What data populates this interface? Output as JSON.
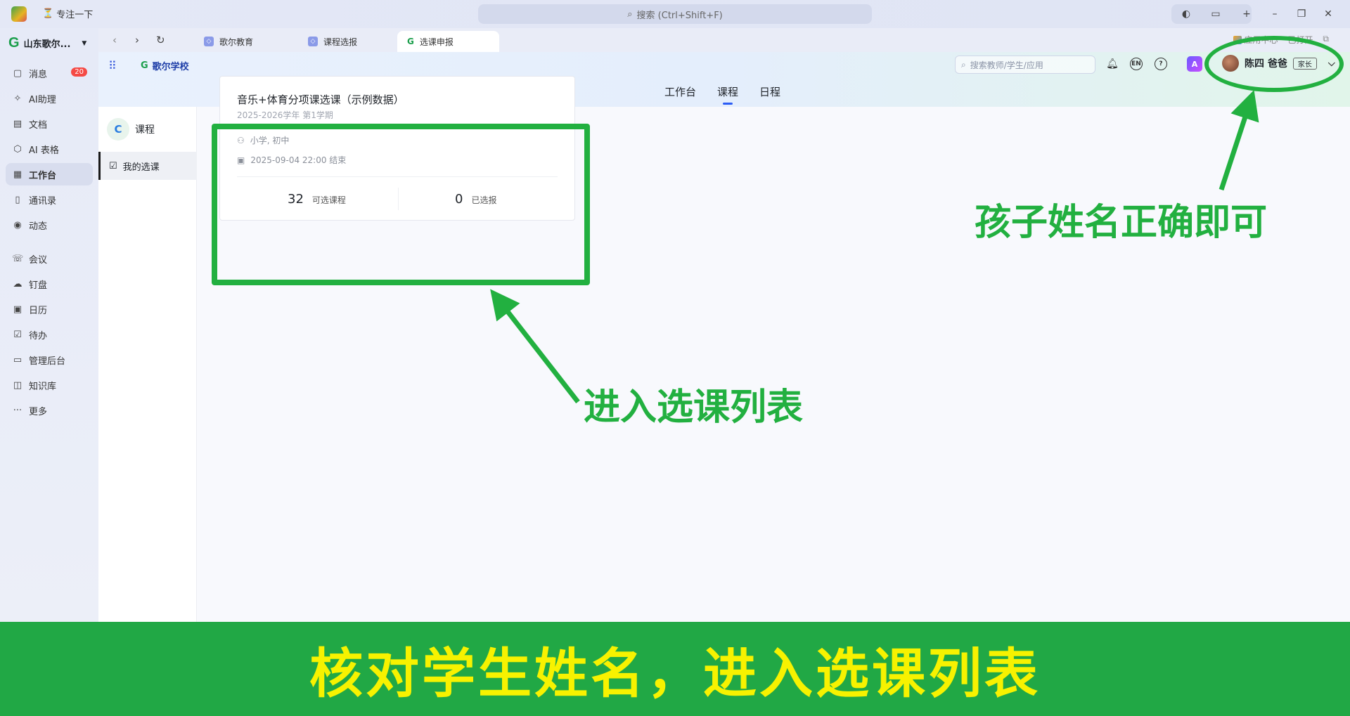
{
  "titlebar": {
    "focus_label": "专注一下",
    "search_placeholder": "搜索 (Ctrl+Shift+F)"
  },
  "sidebar": {
    "org_name": "山东歌尔...",
    "items": [
      {
        "label": "消息",
        "icon": "message-icon",
        "badge": "20"
      },
      {
        "label": "AI助理",
        "icon": "sparkle-icon"
      },
      {
        "label": "文档",
        "icon": "doc-icon"
      },
      {
        "label": "AI 表格",
        "icon": "table-icon"
      },
      {
        "label": "工作台",
        "icon": "grid-icon",
        "active": true
      },
      {
        "label": "通讯录",
        "icon": "contacts-icon"
      },
      {
        "label": "动态",
        "icon": "eye-icon"
      },
      {
        "label": "会议",
        "icon": "phone-icon"
      },
      {
        "label": "钉盘",
        "icon": "cloud-icon"
      },
      {
        "label": "日历",
        "icon": "calendar-icon"
      },
      {
        "label": "待办",
        "icon": "checkbox-icon"
      },
      {
        "label": "管理后台",
        "icon": "monitor-icon"
      },
      {
        "label": "知识库",
        "icon": "book-icon"
      },
      {
        "label": "更多",
        "icon": "more-icon"
      }
    ]
  },
  "tabs": [
    {
      "label": "歌尔教育"
    },
    {
      "label": "课程选报"
    },
    {
      "label": "选课申报",
      "active": true
    }
  ],
  "tabbar_right": {
    "app_center": "应用中心",
    "extra": "已打开"
  },
  "app_header": {
    "school_name": "歌尔学校",
    "nav": [
      "工作台",
      "课程",
      "日程"
    ],
    "active_nav": "课程",
    "search_placeholder": "搜索教师/学生/应用",
    "lang_label": "EN",
    "help_label": "?",
    "user_name": "陈四 爸爸",
    "user_role": "家长"
  },
  "sub_sidebar": {
    "title": "课程",
    "item": "我的选课"
  },
  "course_card": {
    "title": "音乐+体育分项课选课（示例数据）",
    "term": "2025-2026学年 第1学期",
    "grades": "小学, 初中",
    "deadline": "2025-09-04 22:00 结束",
    "available_count": "32",
    "available_label": "可选课程",
    "selected_count": "0",
    "selected_label": "已选报"
  },
  "annotations": {
    "right_note": "孩子姓名正确即可",
    "center_note": "进入选课列表",
    "highlight_color": "#22b040"
  },
  "banner": {
    "text": "核对学生姓名，进入选课列表",
    "bg_color": "#21a845",
    "text_color": "#f7f200"
  }
}
